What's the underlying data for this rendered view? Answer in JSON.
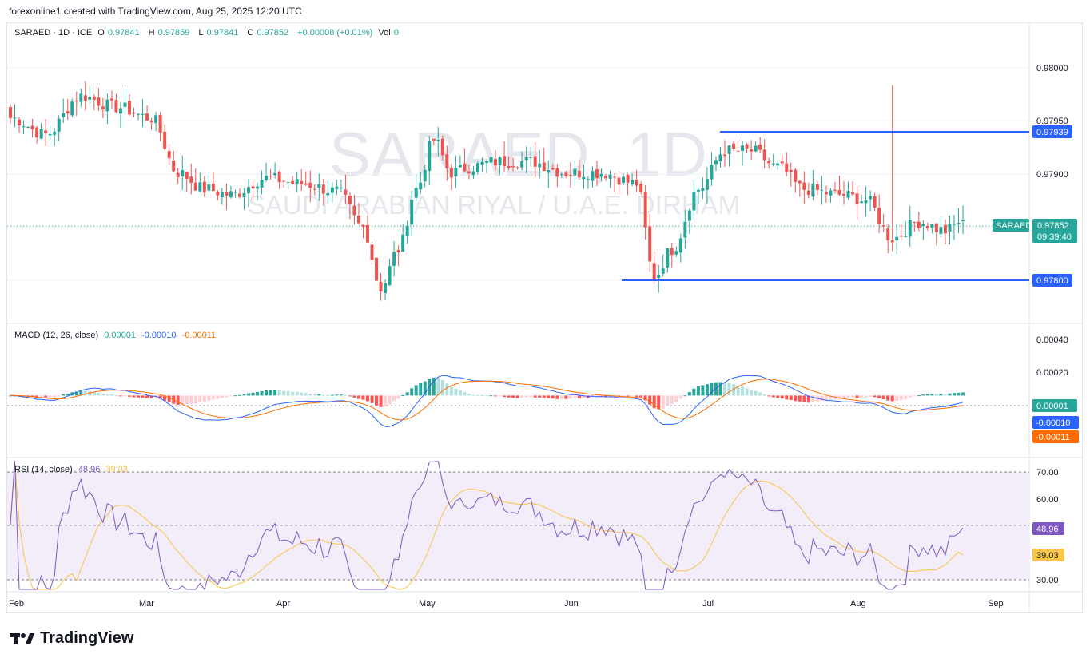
{
  "header": {
    "creator_line": "forexonline1 created with TradingView.com, Aug 25, 2025 12:20 UTC"
  },
  "legend": {
    "symbol_line": "SARAED · 1D · ICE",
    "o_label": "O",
    "o_value": "0.97841",
    "h_label": "H",
    "h_value": "0.97859",
    "l_label": "L",
    "l_value": "0.97841",
    "c_label": "C",
    "c_value": "0.97852",
    "change": "+0.00008 (+0.01%)",
    "vol_label": "Vol",
    "vol_value": "0"
  },
  "watermark": {
    "symbol": "SARAED, 1D",
    "description": "SAUDI ARABIAN RIYAL / U.A.E. DIRHAM"
  },
  "price_badges": {
    "symbol_tag": "SARAED",
    "last_price": "0.97852",
    "countdown": "09:39:40",
    "upper_line_price": "0.97939",
    "lower_line_price": "0.97800"
  },
  "macd": {
    "title": "MACD (12, 26, close)",
    "hist_value": "0.00001",
    "macd_value": "-0.00010",
    "signal_value": "-0.00011"
  },
  "rsi": {
    "title": "RSI (14, close)",
    "rsi_value": "48.96",
    "ma_value": "39.03"
  },
  "axes": {
    "price_ticks": [
      "0.98000",
      "0.97950",
      "0.97900"
    ],
    "macd_ticks": [
      "0.00040",
      "0.00020"
    ],
    "rsi_ticks": [
      "70.00",
      "60.00",
      "30.00"
    ],
    "time_ticks": [
      "Feb",
      "Mar",
      "Apr",
      "May",
      "Jun",
      "Jul",
      "Aug",
      "Sep"
    ]
  },
  "colors": {
    "up": "#26a69a",
    "down": "#ef5350",
    "level_line": "#2962ff",
    "macd_line": "#2962ff",
    "signal_line": "#ff6d00",
    "rsi_line": "#7e57c2",
    "rsi_ma": "#f7c548"
  },
  "footer": {
    "brand": "TradingView"
  },
  "chart_data": {
    "type": "candlestick",
    "title": "SARAED · 1D · ICE",
    "symbol": "SARAED",
    "timeframe": "1D",
    "x_range": [
      "2025-01-31",
      "2025-09-09"
    ],
    "price_ylim": [
      0.97761,
      0.98025
    ],
    "price_scale": "linear",
    "x_axis_months": [
      "Feb",
      "Mar",
      "Apr",
      "May",
      "Jun",
      "Jul",
      "Aug",
      "Sep"
    ],
    "horizontal_levels": [
      0.97939,
      0.978
    ],
    "last_price": 0.97852,
    "ohlc_last_bar": {
      "open": 0.97841,
      "high": 0.97859,
      "low": 0.97841,
      "close": 0.97852
    },
    "macd": {
      "fast": 12,
      "slow": 26,
      "source": "close",
      "ylim": [
        -0.00045,
        0.00052
      ],
      "histogram_last": 1e-05,
      "macd_last": -0.0001,
      "signal_last": -0.00011
    },
    "rsi": {
      "length": 14,
      "source": "close",
      "ylim": [
        26.5,
        73.5
      ],
      "band": [
        30,
        70
      ],
      "midline": 50,
      "rsi_last": 48.96,
      "ma_last": 39.03
    }
  }
}
